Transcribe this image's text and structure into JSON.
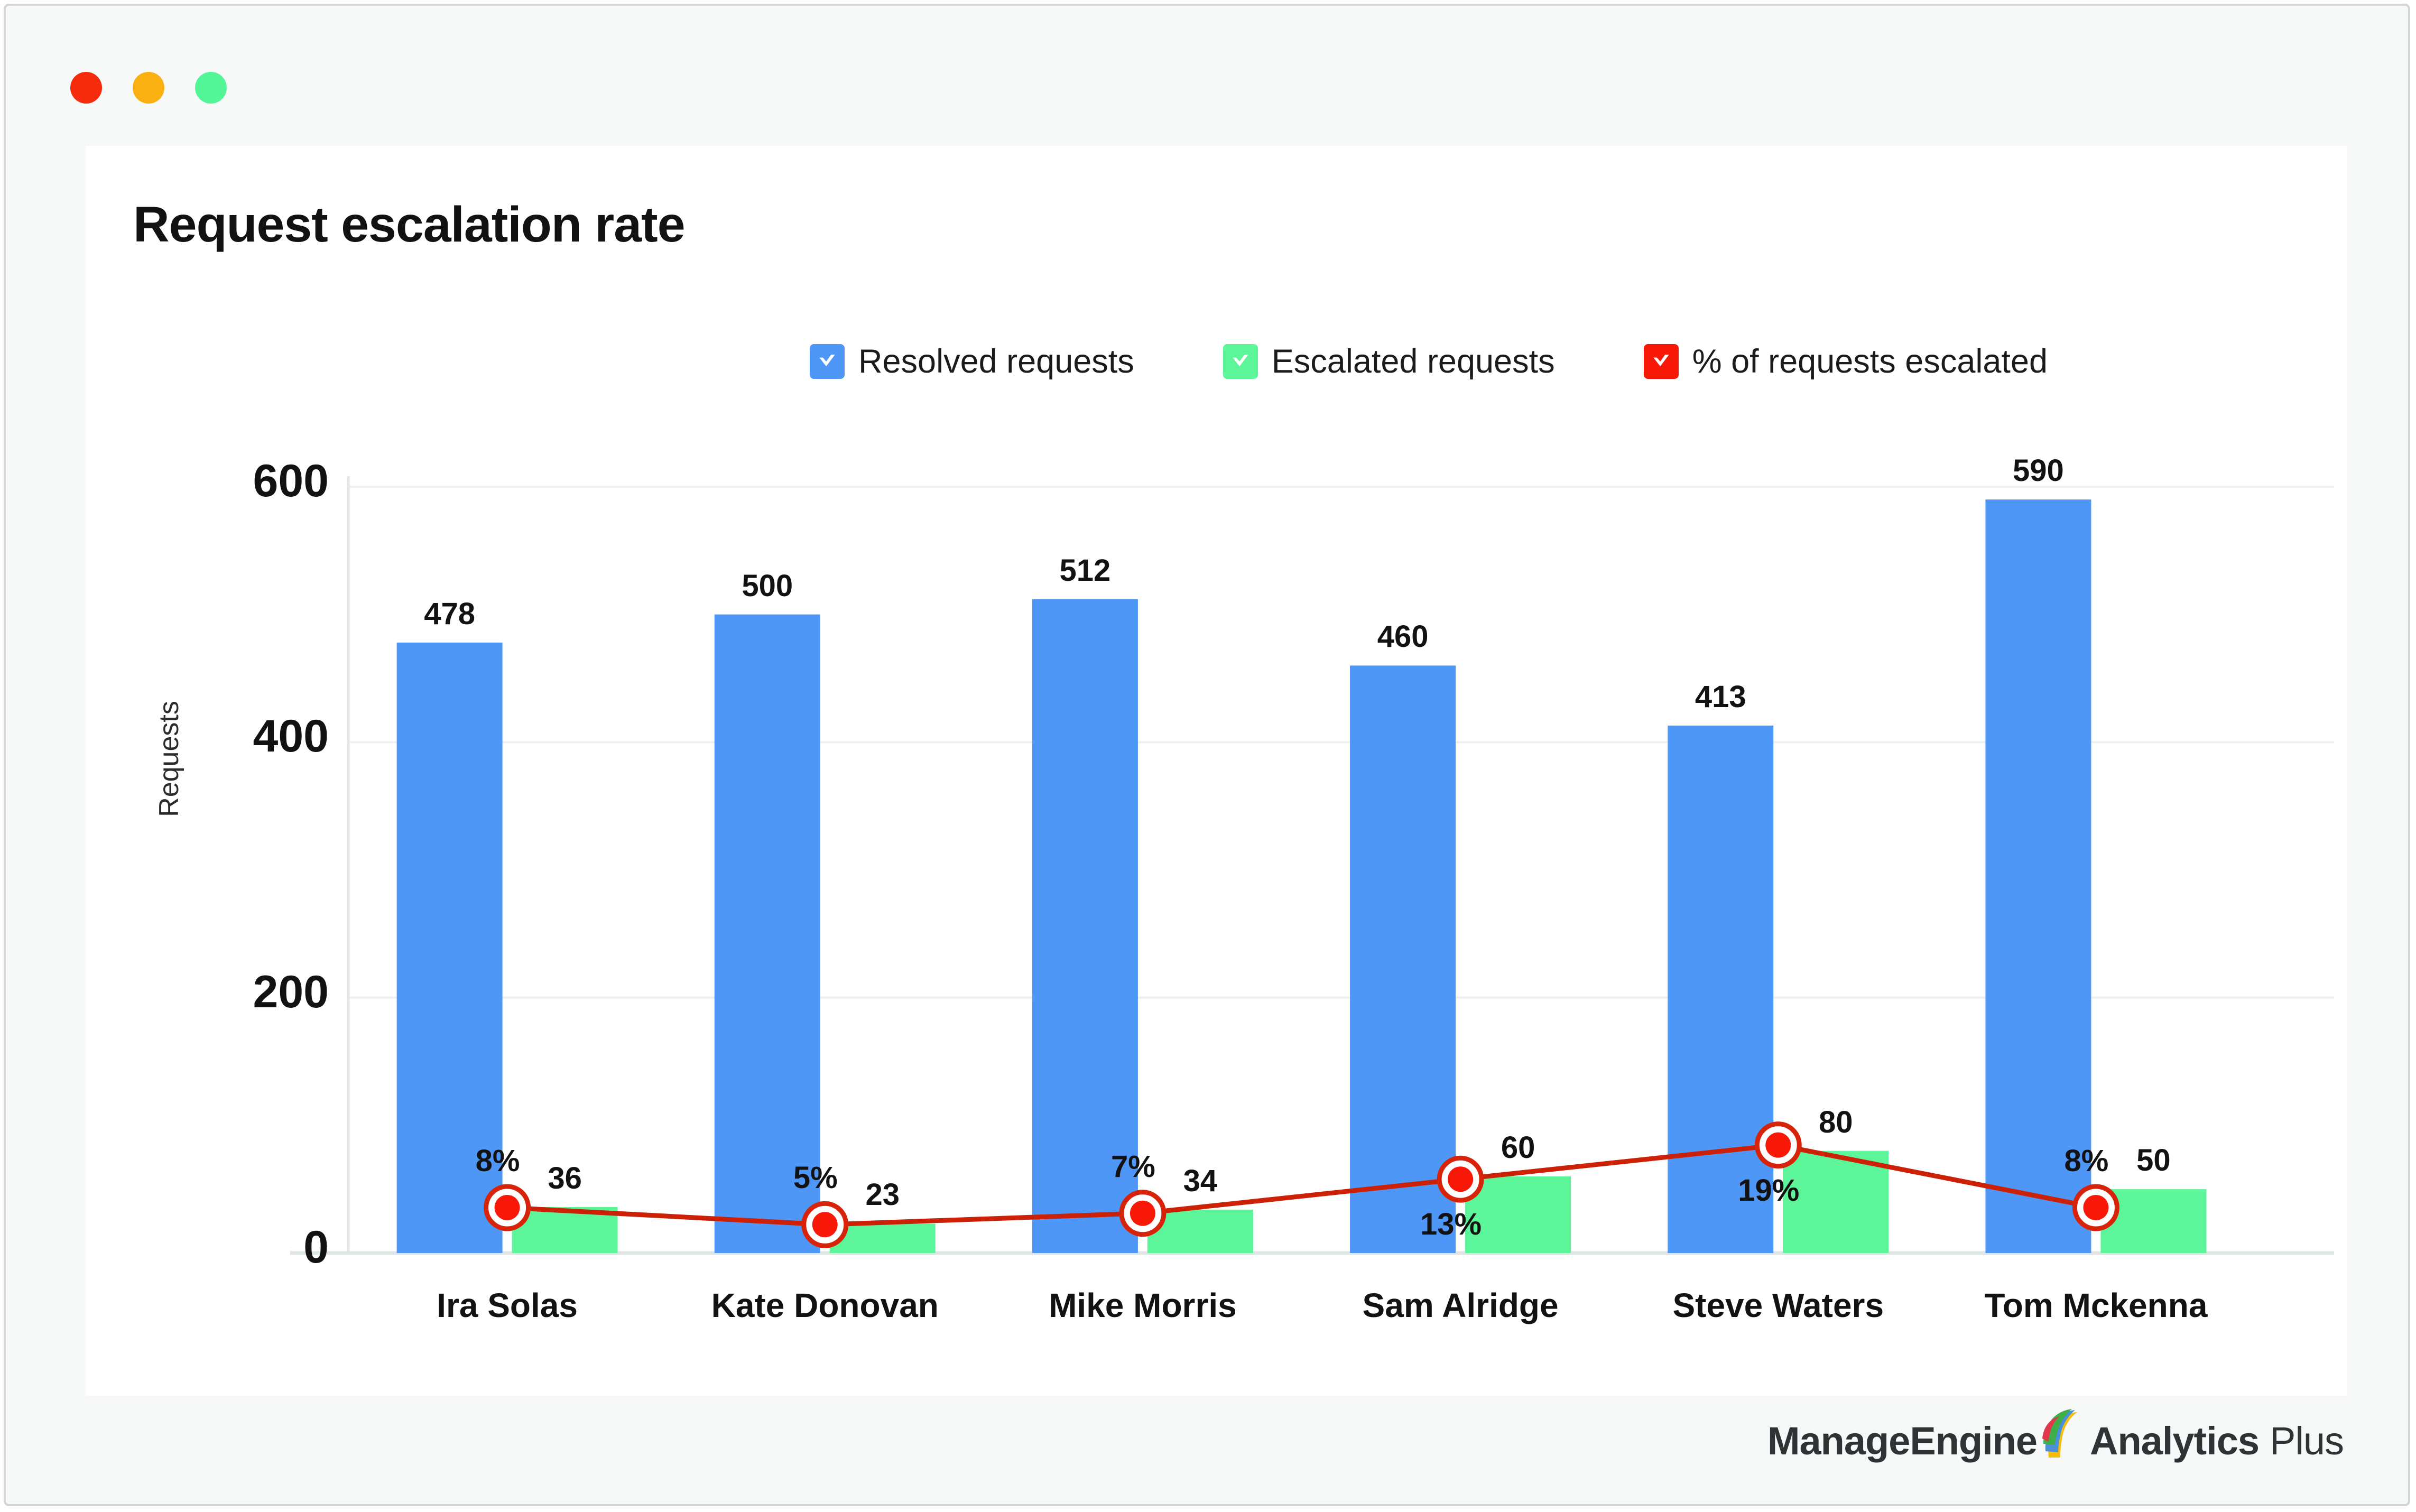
{
  "window": {
    "traffic_lights": [
      {
        "name": "close",
        "color": "#F42B0C"
      },
      {
        "name": "minimize",
        "color": "#FBB012"
      },
      {
        "name": "maximize",
        "color": "#53F596"
      }
    ]
  },
  "card": {
    "title": "Request escalation rate"
  },
  "legend": {
    "items": [
      {
        "label": "Resolved requests",
        "color": "#4F97F7",
        "icon": "checkbox-checked-icon"
      },
      {
        "label": "Escalated requests",
        "color": "#5CF59A",
        "icon": "checkbox-checked-icon"
      },
      {
        "label": "% of requests escalated",
        "color": "#F81807",
        "icon": "checkbox-checked-icon"
      }
    ]
  },
  "footer": {
    "logo_part1": "Manage",
    "logo_part2": "Engine",
    "logo_part3": "Analytics",
    "logo_part4": "Plus"
  },
  "chart_data": {
    "type": "bar",
    "title": "Request escalation rate",
    "xlabel": "",
    "ylabel": "Requests",
    "ylim": [
      0,
      600
    ],
    "yticks": [
      0,
      200,
      400,
      600
    ],
    "ytick_labels": [
      "0",
      "200",
      "400",
      "600"
    ],
    "grid": true,
    "legend_position": "top",
    "categories": [
      "Ira Solas",
      "Kate Donovan",
      "Mike Morris",
      "Sam Alridge",
      "Steve Waters",
      "Tom Mckenna"
    ],
    "series": [
      {
        "name": "Resolved requests",
        "type": "bar",
        "color": "#4F97F7",
        "values": [
          478,
          500,
          512,
          460,
          413,
          590
        ],
        "labels": [
          "478",
          "500",
          "512",
          "460",
          "413",
          "590"
        ]
      },
      {
        "name": "Escalated requests",
        "type": "bar",
        "color": "#5CF59A",
        "values": [
          36,
          23,
          34,
          60,
          80,
          50
        ],
        "labels": [
          "36",
          "23",
          "34",
          "60",
          "80",
          "50"
        ]
      },
      {
        "name": "% of requests escalated",
        "type": "line",
        "color": "#CC2007",
        "marker_fill": "#F81807",
        "values": [
          8,
          5,
          7,
          13,
          19,
          8
        ],
        "labels": [
          "8%",
          "5%",
          "7%",
          "13%",
          "19%",
          "8%"
        ],
        "label_positions": [
          "above",
          "above",
          "above",
          "below",
          "below",
          "above"
        ],
        "secondary_axis": true,
        "secondary_ylim": [
          0,
          600
        ]
      }
    ]
  }
}
